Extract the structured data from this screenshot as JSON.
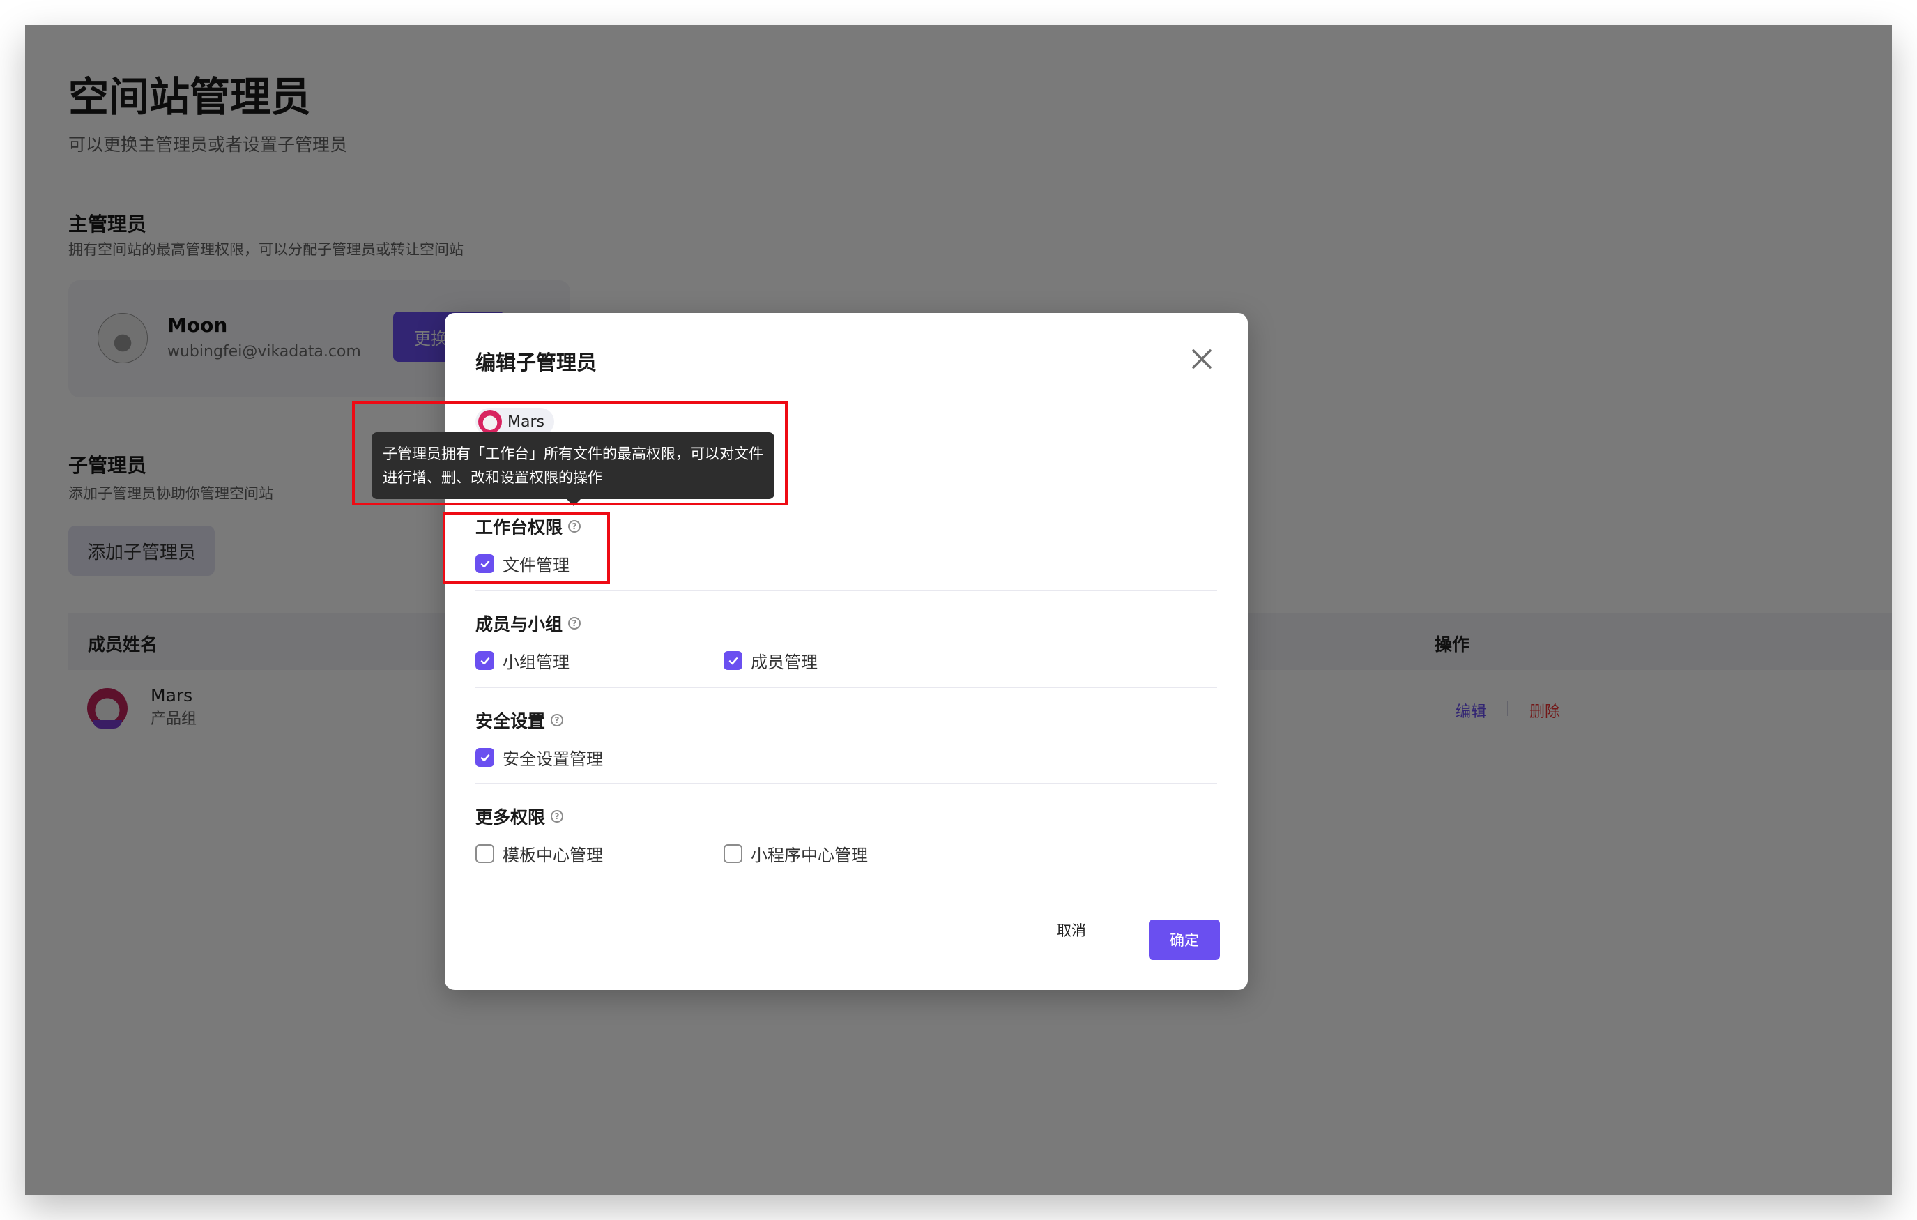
{
  "page": {
    "title": "空间站管理员",
    "subtitle": "可以更换主管理员或者设置子管理员",
    "main_admin": {
      "section_title": "主管理员",
      "section_desc": "拥有空间站的最高管理权限，可以分配子管理员或转让空间站",
      "name": "Moon",
      "email": "wubingfei@vikadata.com",
      "change_button": "更换"
    },
    "sub_admin": {
      "section_title": "子管理员",
      "section_desc": "添加子管理员协助你管理空间站",
      "add_button": "添加子管理员",
      "table": {
        "columns": [
          "成员姓名",
          "操作"
        ],
        "rows": [
          {
            "name": "Mars",
            "group": "产品组",
            "actions": {
              "edit": "编辑",
              "delete": "删除"
            }
          }
        ]
      }
    }
  },
  "modal": {
    "title": "编辑子管理员",
    "member_chip": "Mars",
    "tooltip": "子管理员拥有「工作台」所有文件的最高权限，可以对文件进行增、删、改和设置权限的操作",
    "sections": [
      {
        "title": "工作台权限",
        "options": [
          {
            "label": "文件管理",
            "checked": true
          }
        ]
      },
      {
        "title": "成员与小组",
        "options": [
          {
            "label": "小组管理",
            "checked": true
          },
          {
            "label": "成员管理",
            "checked": true
          }
        ]
      },
      {
        "title": "安全设置",
        "options": [
          {
            "label": "安全设置管理",
            "checked": true
          }
        ]
      },
      {
        "title": "更多权限",
        "options": [
          {
            "label": "模板中心管理",
            "checked": false
          },
          {
            "label": "小程序中心管理",
            "checked": false
          }
        ]
      }
    ],
    "cancel_button": "取消",
    "ok_button": "确定"
  },
  "colors": {
    "accent": "#6a4ff0",
    "danger": "#e33333",
    "highlight": "#ee0a14",
    "tooltip_bg": "#2d2d2d"
  }
}
